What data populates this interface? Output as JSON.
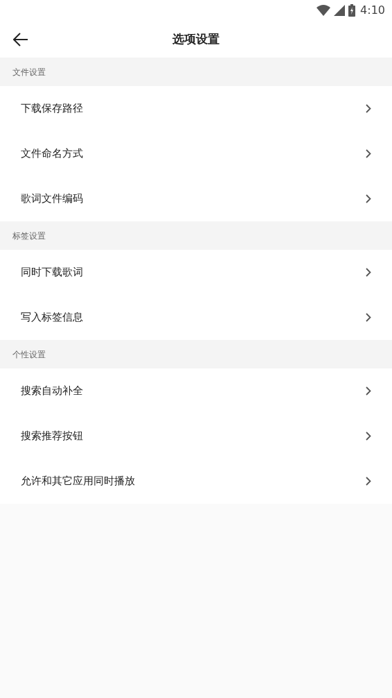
{
  "status_bar": {
    "time": "4:10"
  },
  "header": {
    "title": "选项设置"
  },
  "sections": [
    {
      "title": "文件设置",
      "items": [
        {
          "label": "下载保存路径"
        },
        {
          "label": "文件命名方式"
        },
        {
          "label": "歌词文件编码"
        }
      ]
    },
    {
      "title": "标签设置",
      "items": [
        {
          "label": "同时下载歌词"
        },
        {
          "label": "写入标签信息"
        }
      ]
    },
    {
      "title": "个性设置",
      "items": [
        {
          "label": "搜索自动补全"
        },
        {
          "label": "搜索推荐按钮"
        },
        {
          "label": "允许和其它应用同时播放"
        }
      ]
    }
  ]
}
